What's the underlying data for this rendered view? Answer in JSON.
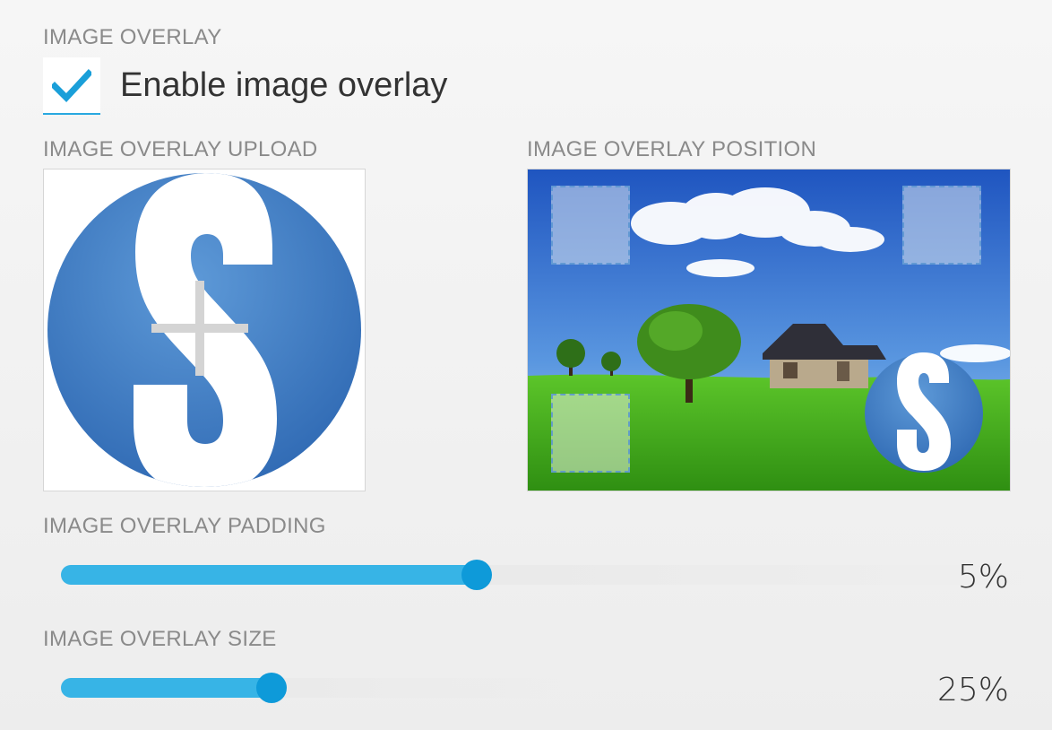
{
  "overlay": {
    "section_label": "IMAGE OVERLAY",
    "enable_label": "Enable image overlay",
    "enabled": true
  },
  "upload": {
    "label": "IMAGE OVERLAY UPLOAD",
    "icon": "logo-s-icon"
  },
  "position": {
    "label": "IMAGE OVERLAY POSITION",
    "selected": "bottom-right",
    "slots": [
      "top-left",
      "top-right",
      "bottom-left",
      "bottom-right"
    ]
  },
  "padding": {
    "label": "IMAGE OVERLAY PADDING",
    "value": "5%",
    "fraction": 0.43
  },
  "size": {
    "label": "IMAGE OVERLAY SIZE",
    "value": "25%",
    "fraction": 0.42
  },
  "colors": {
    "accent": "#29a8e0",
    "slider_fill": "#37b4e6",
    "logo_blue": "#3f7cc4"
  }
}
